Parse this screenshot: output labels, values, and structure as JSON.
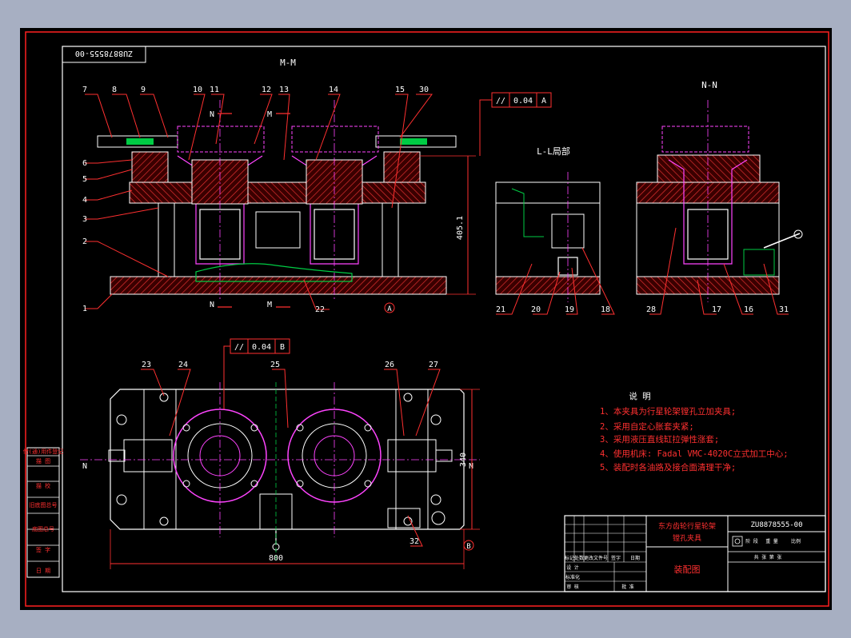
{
  "drawing_number": "ZU8878555-00",
  "drawing_number_rotated": "ZU8878555-00",
  "views": {
    "section_m": "M-M",
    "detail_l": "L-L局部",
    "section_n": "N-N",
    "cut_n": "N",
    "cut_m": "M"
  },
  "datums": {
    "a": "A",
    "b": "B"
  },
  "tolerances": {
    "parallel_a": {
      "symbol": "//",
      "value": "0.04",
      "datum": "A"
    },
    "parallel_b": {
      "symbol": "//",
      "value": "0.04",
      "datum": "B"
    }
  },
  "dimensions": {
    "height": "405.1",
    "length": "800",
    "width": "340"
  },
  "part_labels": {
    "front": [
      "7",
      "8",
      "9",
      "10",
      "11",
      "12",
      "13",
      "14",
      "15",
      "30",
      "6",
      "5",
      "4",
      "3",
      "2",
      "1",
      "22"
    ],
    "detail": [
      "21",
      "20",
      "19",
      "18"
    ],
    "side": [
      "28",
      "17",
      "16",
      "31"
    ],
    "plan": [
      "23",
      "24",
      "25",
      "26",
      "27",
      "32"
    ]
  },
  "notes": {
    "title": "说 明",
    "items": [
      "1、本夹具为行星轮架镗孔立加夹具;",
      "2、采用自定心胀套夹紧;",
      "3、采用液压直线缸拉弹性涨套;",
      "4、使用机床: Fadal VMC-4020C立式加工中心;",
      "5、装配时各油路及接合面清理干净;"
    ]
  },
  "left_strip": [
    "借(通)用件登记",
    "描 图",
    "描 校",
    "旧底图总号",
    "底图总号",
    "签 字",
    "日 期"
  ],
  "title_block": {
    "product_line1": "东方齿轮行星轮架",
    "product_line2": "镗孔夹具",
    "drawing_no": "ZU8878555-00",
    "drawing_name": "装配图",
    "row_labels": [
      "标记",
      "处数",
      "更改文件号",
      "签字",
      "日期"
    ],
    "sign_rows": [
      "设 计",
      "标准化",
      "审 核",
      "批 准"
    ],
    "stage_labels": [
      "阶 段",
      "重 量",
      "比例"
    ],
    "sheet_label": "共 张 第 张"
  },
  "colors": {
    "background": "#000000",
    "outer_frame": "#ff0000",
    "part_outline": "#ffffff",
    "section_hatch": "#cc2020",
    "leader": "#ff3030",
    "label": "#ffffff",
    "center_line": "#ff44ff",
    "dimension": "#ff2020"
  }
}
